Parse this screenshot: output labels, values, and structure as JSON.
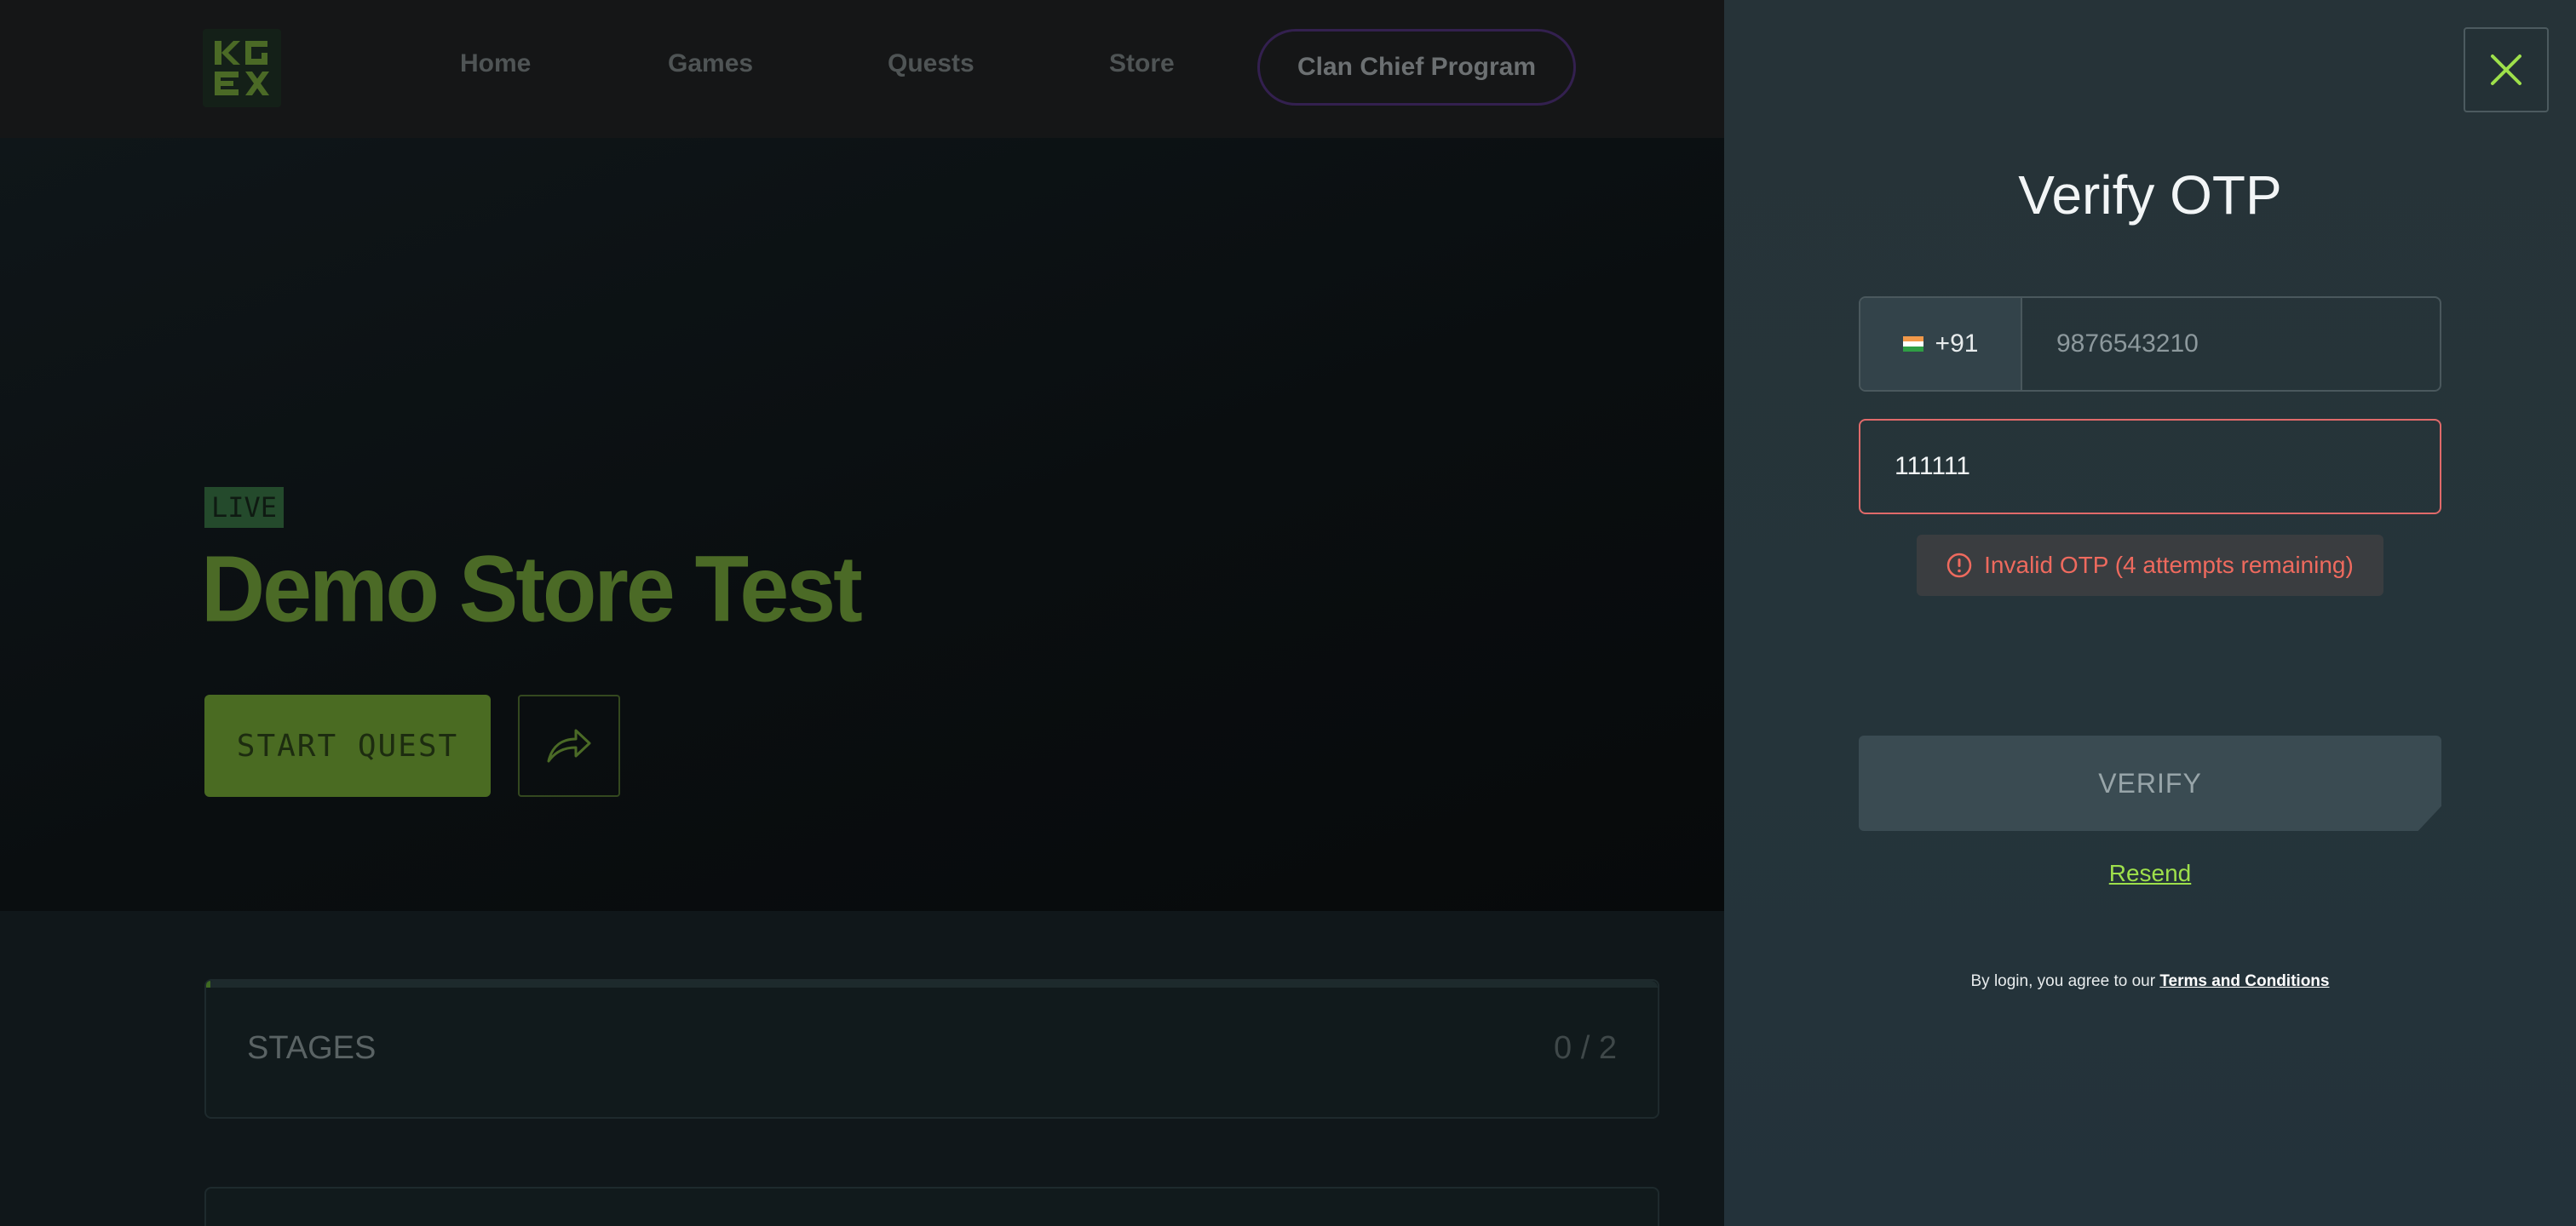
{
  "nav": {
    "home": "Home",
    "games": "Games",
    "quests": "Quests",
    "store": "Store",
    "clan_chief": "Clan Chief Program"
  },
  "hero": {
    "status_badge": "LIVE",
    "title": "Demo Store Test",
    "start_button": "START QUEST"
  },
  "stages": {
    "label": "STAGES",
    "count": "0 / 2",
    "progress_fraction": 0
  },
  "modal": {
    "title": "Verify OTP",
    "country_code": "+91",
    "country_flag": "IN",
    "phone_placeholder": "9876543210",
    "otp_value": "111111",
    "error_message": "Invalid OTP (4 attempts remaining)",
    "verify_button": "VERIFY",
    "resend_link": "Resend",
    "terms_prefix": "By login, you agree to our",
    "terms_link": "Terms and Conditions"
  },
  "colors": {
    "accent_green": "#9ee04b",
    "error_red": "#ee6a5e",
    "panel_bg": "#263338"
  }
}
